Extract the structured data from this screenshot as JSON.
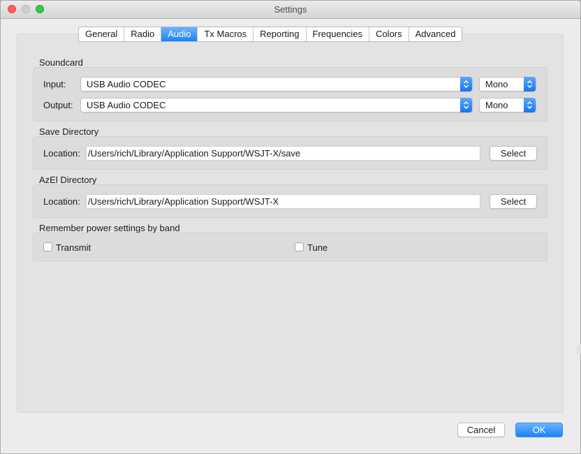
{
  "window": {
    "title": "Settings"
  },
  "tabs": [
    {
      "label": "General",
      "active": false
    },
    {
      "label": "Radio",
      "active": false
    },
    {
      "label": "Audio",
      "active": true
    },
    {
      "label": "Tx Macros",
      "active": false
    },
    {
      "label": "Reporting",
      "active": false
    },
    {
      "label": "Frequencies",
      "active": false
    },
    {
      "label": "Colors",
      "active": false
    },
    {
      "label": "Advanced",
      "active": false
    }
  ],
  "soundcard": {
    "title": "Soundcard",
    "input_label": "Input:",
    "input_device": "USB Audio CODEC",
    "input_channel": "Mono",
    "output_label": "Output:",
    "output_device": "USB Audio CODEC",
    "output_channel": "Mono"
  },
  "save_directory": {
    "title": "Save Directory",
    "location_label": "Location:",
    "path": "/Users/rich/Library/Application Support/WSJT-X/save",
    "select_label": "Select"
  },
  "azel_directory": {
    "title": "AzEl Directory",
    "location_label": "Location:",
    "path": "/Users/rich/Library/Application Support/WSJT-X",
    "select_label": "Select"
  },
  "power": {
    "title": "Remember power settings by band",
    "transmit_label": "Transmit",
    "transmit_checked": false,
    "tune_label": "Tune",
    "tune_checked": false
  },
  "footer": {
    "cancel_label": "Cancel",
    "ok_label": "OK"
  },
  "colors": {
    "accent": "#1a82fb",
    "close": "#fc605c",
    "zoom": "#34c84a"
  },
  "icons": {
    "close": "close-traffic-icon",
    "minimize": "minimize-traffic-icon",
    "zoom": "zoom-traffic-icon",
    "updown": "updown-arrows-icon"
  }
}
